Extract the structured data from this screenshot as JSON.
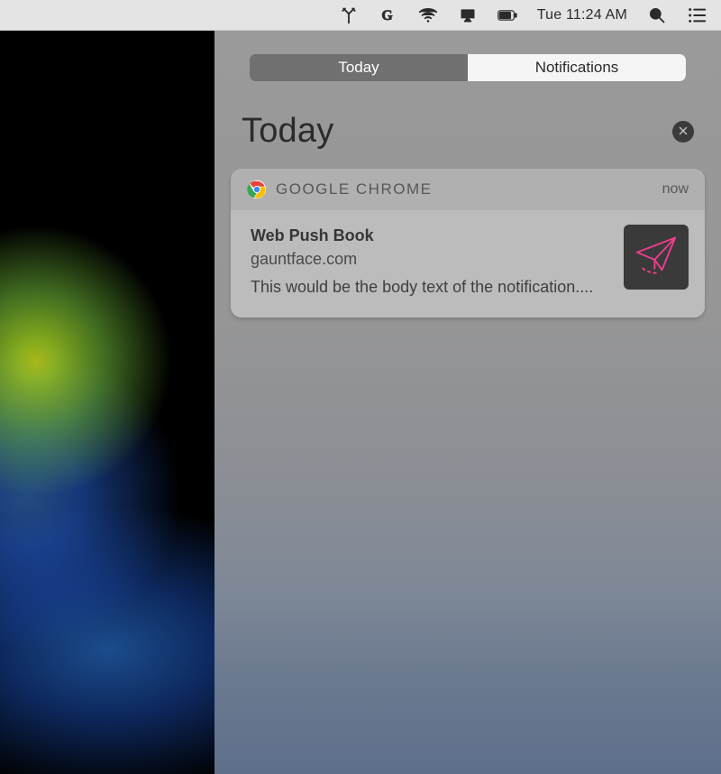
{
  "menubar": {
    "datetime": "Tue 11:24 AM"
  },
  "panel": {
    "tabs": {
      "today": "Today",
      "notifications": "Notifications"
    },
    "heading": "Today"
  },
  "notification": {
    "app": "GOOGLE CHROME",
    "when": "now",
    "title": "Web Push Book",
    "site": "gauntface.com",
    "body": "This would be the body text of the notification...."
  }
}
